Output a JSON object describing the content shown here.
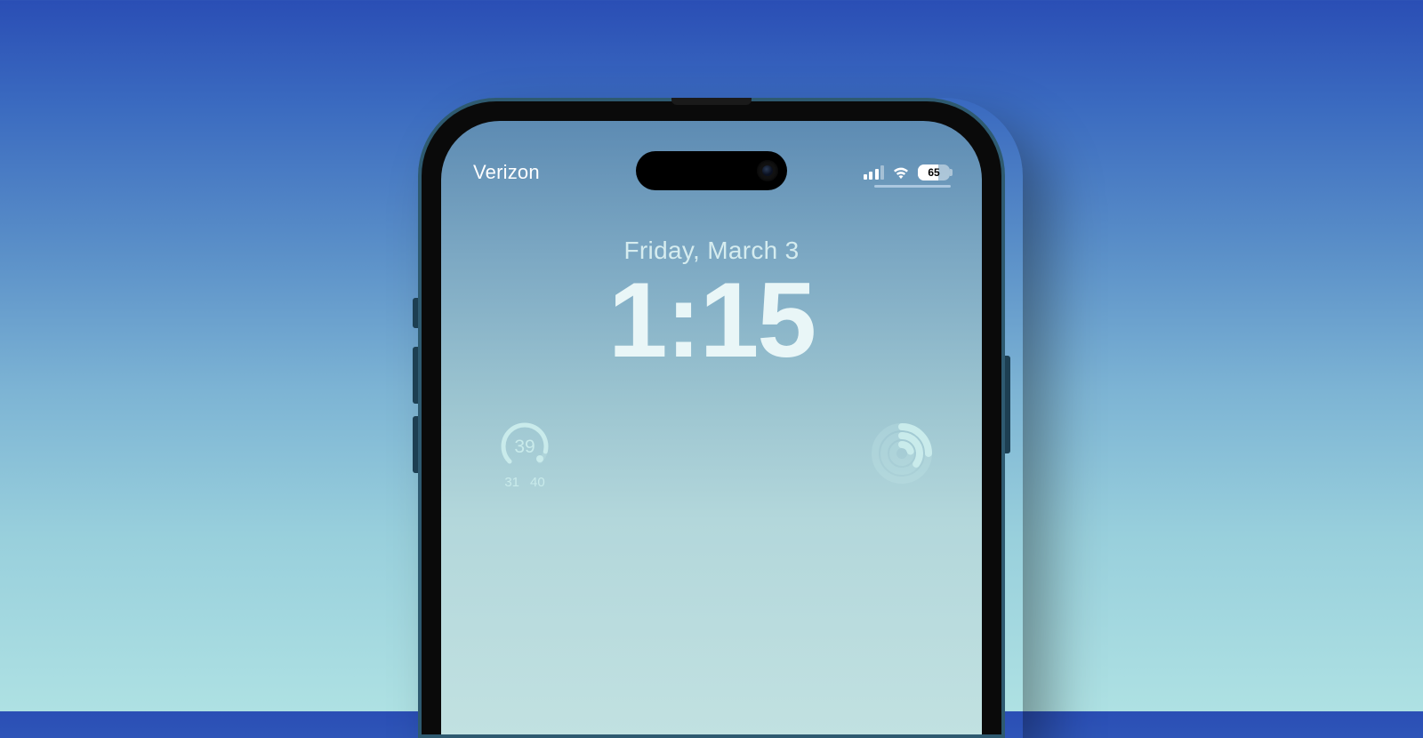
{
  "statusbar": {
    "carrier": "Verizon",
    "signal_bars": 3,
    "wifi": true,
    "battery_pct": 65,
    "battery_label": "65"
  },
  "lockscreen": {
    "date": "Friday, March 3",
    "time": "1:15"
  },
  "widgets": {
    "weather": {
      "current": "39",
      "low": "31",
      "high": "40"
    },
    "activity": {
      "name": "activity-rings"
    }
  },
  "colors": {
    "text_light": "#e9f6f7",
    "accent": "#c9ebeb"
  }
}
